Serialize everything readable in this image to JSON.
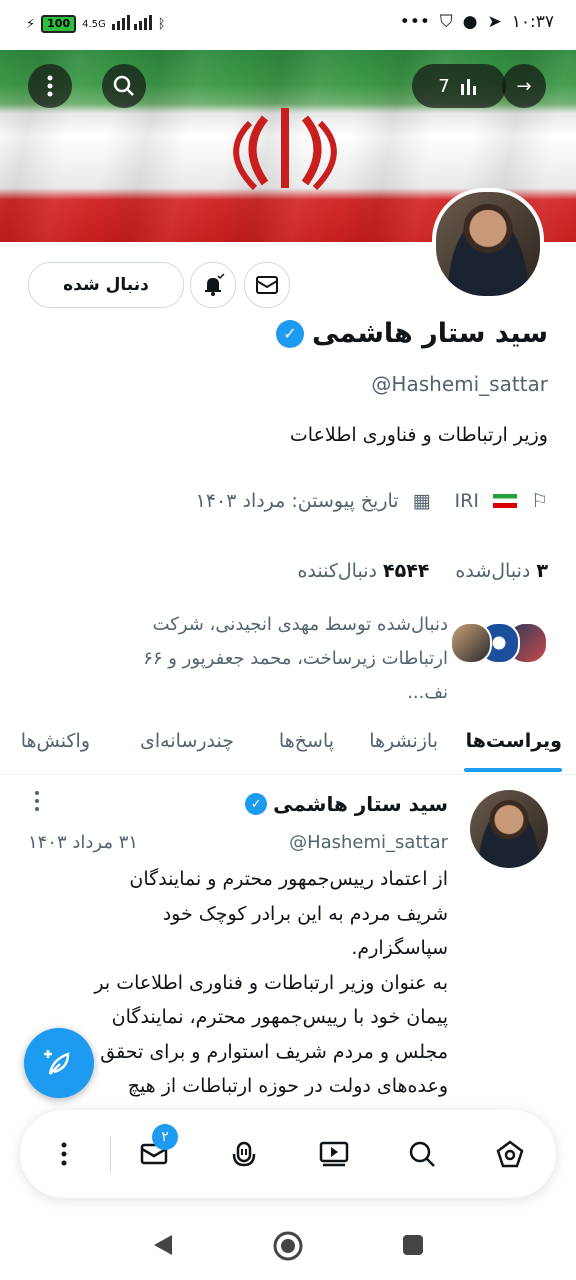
{
  "status_bar": {
    "battery": "100",
    "network": "4.5G",
    "time": "۱۰:۳۷"
  },
  "profile": {
    "name": "سید ستار هاشمی",
    "handle": "@Hashemi_sattar",
    "bio": "وزیر ارتباطات و فناوری اطلاعات",
    "location": "IRI",
    "joined": "تاریخ پیوستن: مرداد ۱۴۰۳",
    "following_count": "۳",
    "following_label": "دنبال‌شده",
    "followers_count": "۴۵۴۴",
    "followers_label": "دنبال‌کننده",
    "followed_by": "دنبال‌شده توسط مهدی انجیدنی، شرکت ارتباطات زیرساخت، محمد جعفرپور و ۶۶ نف...",
    "follow_button": "دنبال شده"
  },
  "banner": {
    "views_count": "7"
  },
  "tabs": [
    {
      "label": "ویراست‌ها",
      "active": true
    },
    {
      "label": "بازنشرها"
    },
    {
      "label": "پاسخ‌ها"
    },
    {
      "label": "چندرسانه‌ای"
    },
    {
      "label": "واکنش‌ها"
    }
  ],
  "tweet": {
    "name": "سید ستار هاشمی",
    "handle": "@Hashemi_sattar",
    "date": "۳۱ مرداد ۱۴۰۳",
    "text": "از اعتماد رییس‌جمهور محترم و نمایندگان\nشریف مردم به این برادر کوچک خود\nسپاسگزارم.\n به عنوان وزیر ارتباطات و فناوری اطلاعات بر\nپیمان خود با رییس‌جمهور محترم، نمایندگان\nمجلس و مردم شریف استوارم و برای تحقق\nوعده‌های دولت در حوزه ارتباطات از هیچ"
  },
  "bottom_nav": {
    "messages_badge": "۲"
  },
  "colors": {
    "accent": "#1d9bf0",
    "text": "#0f1419",
    "muted": "#536471"
  }
}
